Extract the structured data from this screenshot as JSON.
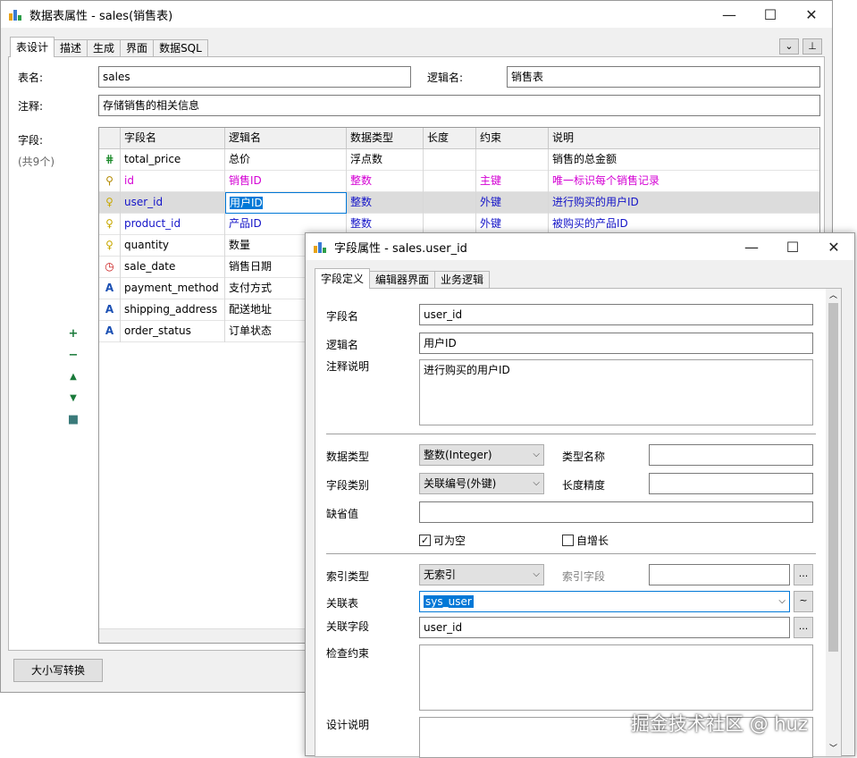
{
  "main_window": {
    "title": "数据表属性 - sales(销售表)",
    "controls": {
      "minimize": "—",
      "maximize": "☐",
      "close": "✕"
    },
    "tabs": [
      "表设计",
      "描述",
      "生成",
      "界面",
      "数据SQL"
    ],
    "table_name_label": "表名:",
    "table_name_value": "sales",
    "logic_name_label": "逻辑名:",
    "logic_name_value": "销售表",
    "comment_label": "注释:",
    "comment_value": "存储销售的相关信息",
    "fields_label": "字段:",
    "fields_count": "(共9个)",
    "case_button": "大小写转换",
    "headers": [
      "字段名",
      "逻辑名",
      "数据类型",
      "长度",
      "约束",
      "说明"
    ],
    "rows": [
      {
        "icon": "number-icon",
        "name": "total_price",
        "logic": "总价",
        "type": "浮点数",
        "length": "",
        "constraint": "",
        "desc": "销售的总金额",
        "color": "#000000"
      },
      {
        "icon": "key-icon",
        "name": "id",
        "logic": "销售ID",
        "type": "整数",
        "length": "",
        "constraint": "主键",
        "desc": "唯一标识每个销售记录",
        "color": "#d400d4"
      },
      {
        "icon": "bulb-icon",
        "name": "user_id",
        "logic": "用户ID",
        "type": "整数",
        "length": "",
        "constraint": "外键",
        "desc": "进行购买的用户ID",
        "color": "#1414c8"
      },
      {
        "icon": "bulb-icon",
        "name": "product_id",
        "logic": "产品ID",
        "type": "整数",
        "length": "",
        "constraint": "外键",
        "desc": "被购买的产品ID",
        "color": "#1414c8"
      },
      {
        "icon": "bulb-icon",
        "name": "quantity",
        "logic": "数量",
        "type": "",
        "length": "",
        "constraint": "",
        "desc": "",
        "color": "#000000"
      },
      {
        "icon": "clock-icon",
        "name": "sale_date",
        "logic": "销售日期",
        "type": "",
        "length": "",
        "constraint": "",
        "desc": "",
        "color": "#000000"
      },
      {
        "icon": "text-icon",
        "name": "payment_method",
        "logic": "支付方式",
        "type": "",
        "length": "",
        "constraint": "",
        "desc": "",
        "color": "#000000"
      },
      {
        "icon": "text-icon",
        "name": "shipping_address",
        "logic": "配送地址",
        "type": "",
        "length": "",
        "constraint": "",
        "desc": "",
        "color": "#000000"
      },
      {
        "icon": "text-icon",
        "name": "order_status",
        "logic": "订单状态",
        "type": "",
        "length": "",
        "constraint": "",
        "desc": "",
        "color": "#000000"
      }
    ],
    "side_tools": [
      "+",
      "−",
      "▲",
      "▼",
      "■"
    ]
  },
  "field_dialog": {
    "title": "字段属性 - sales.user_id",
    "controls": {
      "minimize": "—",
      "maximize": "☐",
      "close": "✕"
    },
    "tabs": [
      "字段定义",
      "编辑器界面",
      "业务逻辑"
    ],
    "field_name_label": "字段名",
    "field_name_value": "user_id",
    "logic_name_label": "逻辑名",
    "logic_name_value": "用户ID",
    "comment_label": "注释说明",
    "comment_value": "进行购买的用户ID",
    "data_type_label": "数据类型",
    "data_type_value": "整数(Integer)",
    "type_name_label": "类型名称",
    "type_name_value": "",
    "field_kind_label": "字段类别",
    "field_kind_value": "关联编号(外键)",
    "precision_label": "长度精度",
    "precision_value": "",
    "default_label": "缺省值",
    "default_value": "",
    "nullable_label": "可为空",
    "nullable_checked": true,
    "autoinc_label": "自增长",
    "autoinc_checked": false,
    "index_type_label": "索引类型",
    "index_type_value": "无索引",
    "index_field_label": "索引字段",
    "index_field_value": "",
    "ref_table_label": "关联表",
    "ref_table_value": "sys_user",
    "ref_field_label": "关联字段",
    "ref_field_value": "user_id",
    "check_label": "检查约束",
    "check_value": "",
    "design_label": "设计说明",
    "design_value": "",
    "ellipsis": "...",
    "tilde": "~"
  },
  "watermark": "掘金技术社区 @ huz"
}
